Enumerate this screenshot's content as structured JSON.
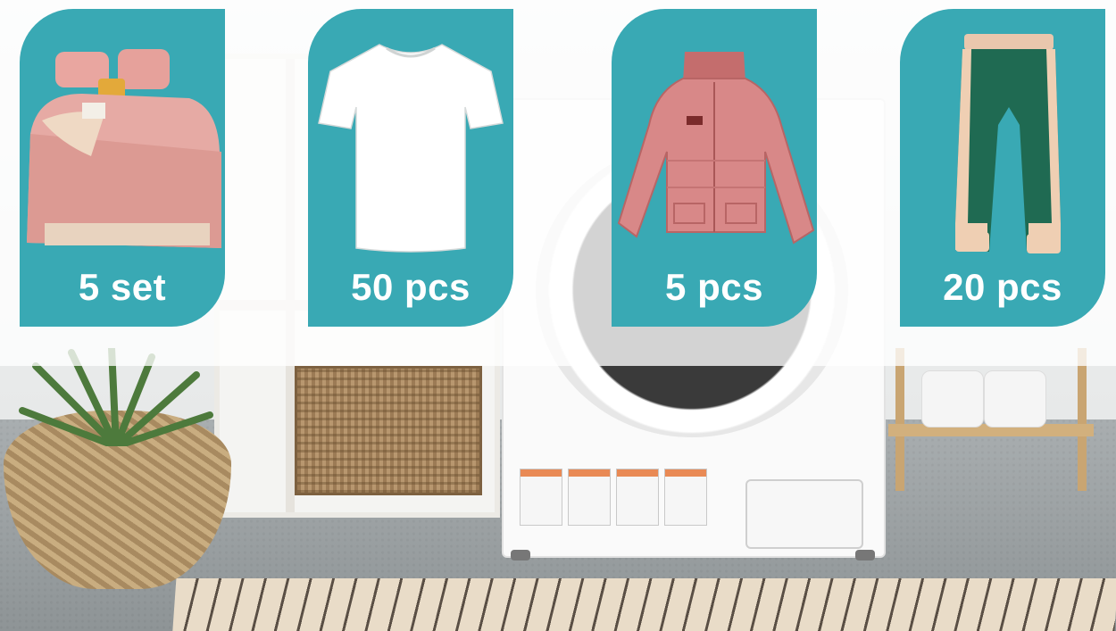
{
  "cards": [
    {
      "item": "bedding set",
      "icon": "bedding-icon",
      "quantity": "5 set"
    },
    {
      "item": "t-shirt",
      "icon": "tshirt-icon",
      "quantity": "50 pcs"
    },
    {
      "item": "jacket",
      "icon": "jacket-icon",
      "quantity": "5 pcs"
    },
    {
      "item": "trousers",
      "icon": "trousers-icon",
      "quantity": "20 pcs"
    }
  ],
  "colors": {
    "card_bg": "#39a9b4",
    "text": "#ffffff"
  }
}
